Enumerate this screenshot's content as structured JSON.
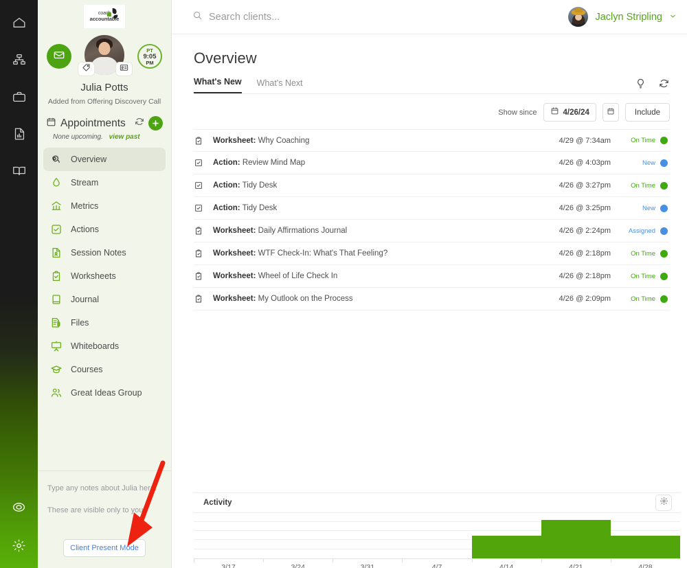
{
  "rail": {
    "top_items": [
      {
        "name": "home-icon",
        "label": "Home"
      },
      {
        "name": "org-chart-icon",
        "label": "Teams"
      },
      {
        "name": "briefcase-icon",
        "label": "Business"
      },
      {
        "name": "report-icon",
        "label": "Reports"
      },
      {
        "name": "book-icon",
        "label": "Library"
      }
    ],
    "bottom_items": [
      {
        "name": "lifebuoy-icon",
        "label": "Support"
      },
      {
        "name": "gear-icon",
        "label": "Settings"
      }
    ]
  },
  "sidebar": {
    "logo": {
      "line1": "coach",
      "line2": "accountable"
    },
    "client": {
      "name": "Julia Potts",
      "subtitle": "Added from Offering Discovery Call",
      "timezone": "PT",
      "time": "9:05",
      "meridiem": "PM"
    },
    "appointments": {
      "title": "Appointments",
      "status": "None upcoming.",
      "link": "view past"
    },
    "nav_items": [
      {
        "label": "Overview",
        "icon": "overview-icon",
        "active": true
      },
      {
        "label": "Stream",
        "icon": "stream-icon",
        "active": false
      },
      {
        "label": "Metrics",
        "icon": "metrics-icon",
        "active": false
      },
      {
        "label": "Actions",
        "icon": "actions-icon",
        "active": false
      },
      {
        "label": "Session Notes",
        "icon": "session-notes-icon",
        "active": false
      },
      {
        "label": "Worksheets",
        "icon": "worksheets-icon",
        "active": false
      },
      {
        "label": "Journal",
        "icon": "journal-icon",
        "active": false
      },
      {
        "label": "Files",
        "icon": "files-icon",
        "active": false
      },
      {
        "label": "Whiteboards",
        "icon": "whiteboards-icon",
        "active": false
      },
      {
        "label": "Courses",
        "icon": "courses-icon",
        "active": false
      },
      {
        "label": "Great Ideas Group",
        "icon": "group-icon",
        "active": false
      }
    ],
    "notes": {
      "line1": "Type any notes about Julia here.",
      "line2": "These are visible only to you.",
      "button": "Client Present Mode"
    }
  },
  "topbar": {
    "search_placeholder": "Search clients...",
    "user_name": "Jaclyn Stripling"
  },
  "main": {
    "page_title": "Overview",
    "tabs": [
      {
        "label": "What's New",
        "active": true
      },
      {
        "label": "What's Next",
        "active": false
      }
    ],
    "header_icons": [
      {
        "name": "lightbulb-icon"
      },
      {
        "name": "refresh-icon"
      }
    ],
    "filters": {
      "show_since_label": "Show since",
      "date_value": "4/26/24",
      "include_label": "Include"
    },
    "rows": [
      {
        "icon": "worksheet-icon",
        "type": "Worksheet:",
        "title": "Why Coaching",
        "time": "4/29 @ 7:34am",
        "status": "On Time",
        "status_color": "#3faa0f"
      },
      {
        "icon": "action-icon",
        "type": "Action:",
        "title": "Review Mind Map",
        "time": "4/26 @ 4:03pm",
        "status": "New",
        "status_color": "#4a90e2"
      },
      {
        "icon": "action-icon",
        "type": "Action:",
        "title": "Tidy Desk",
        "time": "4/26 @ 3:27pm",
        "status": "On Time",
        "status_color": "#3faa0f"
      },
      {
        "icon": "action-icon",
        "type": "Action:",
        "title": "Tidy Desk",
        "time": "4/26 @ 3:25pm",
        "status": "New",
        "status_color": "#4a90e2"
      },
      {
        "icon": "worksheet-icon",
        "type": "Worksheet:",
        "title": "Daily Affirmations Journal",
        "time": "4/26 @ 2:24pm",
        "status": "Assigned",
        "status_color": "#4a90e2"
      },
      {
        "icon": "worksheet-icon",
        "type": "Worksheet:",
        "title": "WTF Check-In: What's That Feeling?",
        "time": "4/26 @ 2:18pm",
        "status": "On Time",
        "status_color": "#3faa0f"
      },
      {
        "icon": "worksheet-icon",
        "type": "Worksheet:",
        "title": "Wheel of Life Check In",
        "time": "4/26 @ 2:18pm",
        "status": "On Time",
        "status_color": "#3faa0f"
      },
      {
        "icon": "worksheet-icon",
        "type": "Worksheet:",
        "title": "My Outlook on the Process",
        "time": "4/26 @ 2:09pm",
        "status": "On Time",
        "status_color": "#3faa0f"
      }
    ]
  },
  "chart_data": {
    "type": "bar",
    "title": "Activity",
    "categories": [
      "3/17",
      "3/24",
      "3/31",
      "4/7",
      "4/14",
      "4/21",
      "4/28"
    ],
    "values": [
      0,
      0,
      0,
      0,
      3,
      5,
      3
    ],
    "xlabel": "",
    "ylabel": "",
    "ylim": [
      0,
      6
    ],
    "grid": true,
    "gridlines": [
      1,
      2,
      3,
      4,
      5
    ],
    "bar_color": "#52a50a",
    "legend": "none"
  }
}
